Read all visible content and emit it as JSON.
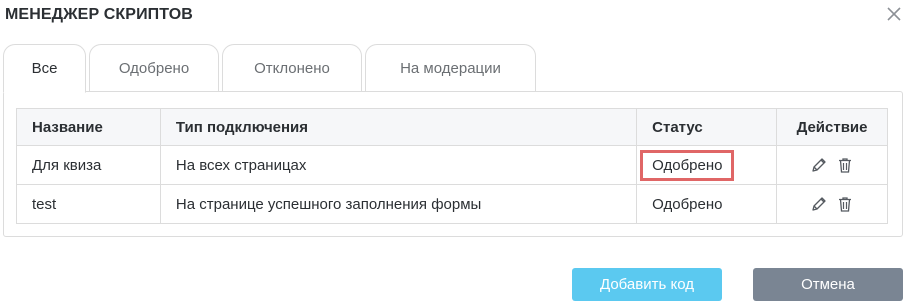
{
  "dialog": {
    "title": "МЕНЕДЖЕР СКРИПТОВ",
    "close_icon": "close-icon"
  },
  "tabs": [
    {
      "label": "Все",
      "active": true
    },
    {
      "label": "Одобрено",
      "active": false
    },
    {
      "label": "Отклонено",
      "active": false
    },
    {
      "label": "На модерации",
      "active": false
    }
  ],
  "table": {
    "columns": [
      "Название",
      "Тип подключения",
      "Статус",
      "Действие"
    ],
    "rows": [
      {
        "name": "Для квиза",
        "type": "На всех страницах",
        "status": "Одобрено",
        "highlighted": true
      },
      {
        "name": "test",
        "type": "На странице успешного заполнения формы",
        "status": "Одобрено",
        "highlighted": false
      }
    ],
    "action_icons": [
      "pencil-icon",
      "trash-icon"
    ],
    "highlight_color": "#e06666"
  },
  "buttons": {
    "add_label": "Добавить код",
    "cancel_label": "Отмена",
    "add_color": "#5bc9f0",
    "cancel_color": "#7a8593"
  }
}
